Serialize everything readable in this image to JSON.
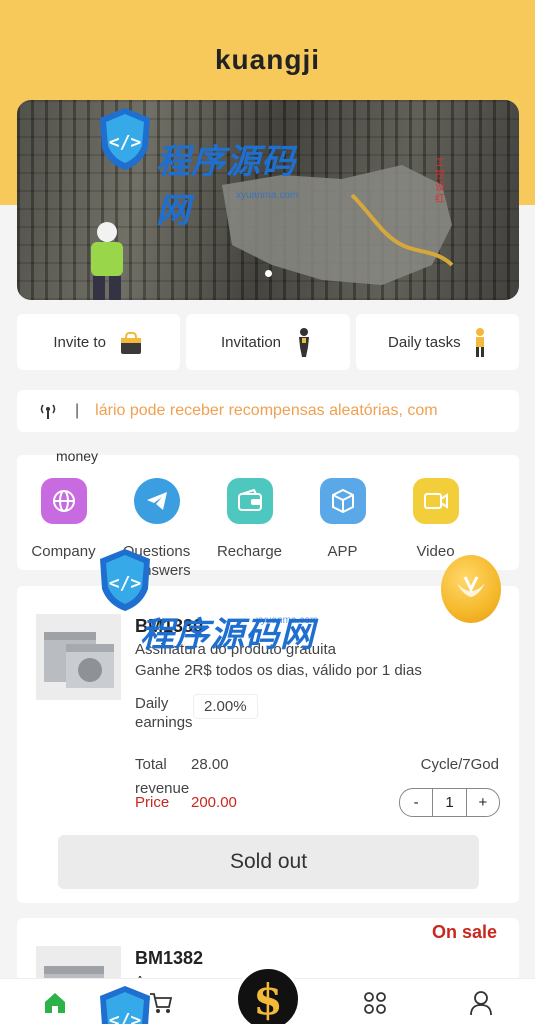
{
  "header": {
    "title": "kuangji"
  },
  "banner": {
    "sign_text": "工控设红"
  },
  "quick_links": [
    {
      "label": "Invite to"
    },
    {
      "label": "Invitation"
    },
    {
      "label": "Daily tasks"
    }
  ],
  "notice": {
    "separator": "|",
    "text": "lário pode receber recompensas aleatórias, com"
  },
  "menu": {
    "overflow_text": "money",
    "items": [
      {
        "label": "Company",
        "icon": "globe-icon",
        "color": "#c86be0"
      },
      {
        "label": "Questions\nd answers",
        "icon": "telegram-icon",
        "color": "#3a9ee0"
      },
      {
        "label": "Recharge",
        "icon": "wallet-icon",
        "color": "#4ec8be"
      },
      {
        "label": "APP",
        "icon": "cube-icon",
        "color": "#5aa8e8"
      },
      {
        "label": "Video",
        "icon": "video-icon",
        "color": "#f2cf3a"
      }
    ]
  },
  "products": [
    {
      "name": "BM1380",
      "status": "So",
      "desc1": "Assinatura do produto gratuita",
      "desc2": "Ganhe 2R$ todos os dias, válido por 1 dias",
      "daily_label": "Daily earnings",
      "daily_value": "2.00%",
      "total_label": "Total revenue",
      "total_value": "28.00",
      "cycle": "Cycle/7God",
      "price_label": "Price",
      "price_value": "200.00",
      "quantity": "1",
      "minus": "-",
      "plus": "+",
      "button": "Sold out"
    },
    {
      "name": "BM1382",
      "status": "On sale",
      "desc1": "A..."
    }
  ],
  "watermark": {
    "brand": "程序源码网",
    "sub": "xyuanma.com"
  },
  "tabbar": {
    "items": [
      {
        "icon": "home-icon",
        "active_color": "#2bb34a"
      },
      {
        "icon": "cart-icon"
      },
      {
        "icon": "dollar-icon",
        "symbol": "$"
      },
      {
        "icon": "discover-icon"
      },
      {
        "icon": "user-icon"
      }
    ]
  }
}
